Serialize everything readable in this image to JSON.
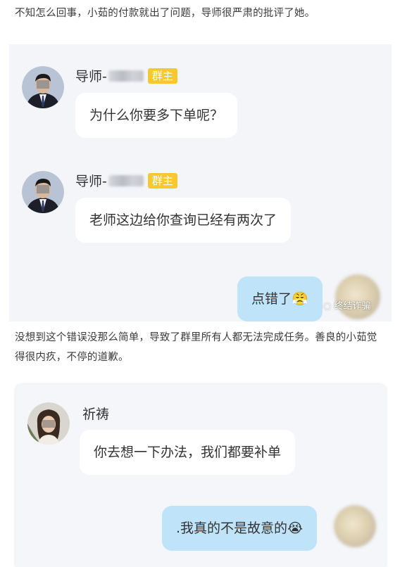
{
  "intro_paragraph": "不知怎么回事，小茹的付款就出了问题，导师很严肃的批评了她。",
  "chat1": {
    "messages": [
      {
        "sender": "导师-",
        "badge": "群主",
        "text": "为什么你要多下单呢？"
      },
      {
        "sender": "导师-",
        "badge": "群主",
        "text": "老师这边给你查询已经有两次了"
      }
    ],
    "self_message": "点错了😤",
    "watermark": "终结诈骗"
  },
  "middle_paragraph": "没想到这个错误没那么简单，导致了群里所有人都无法完成任务。善良的小茹觉得很内疚，不停的道歉。",
  "chat2": {
    "messages": [
      {
        "sender": "祈祷",
        "text": "你去想一下办法，我们都要补单"
      }
    ],
    "self_message": ".我真的不是故意的😭"
  }
}
